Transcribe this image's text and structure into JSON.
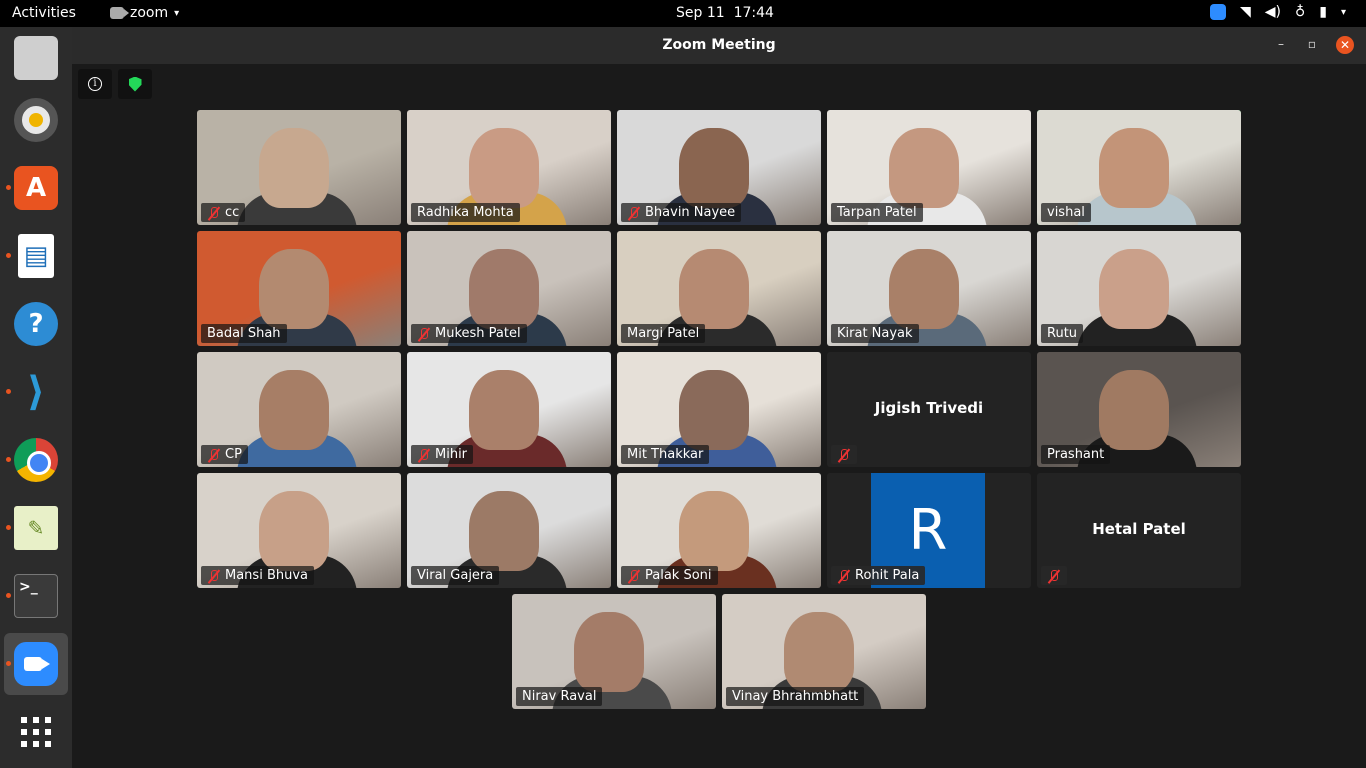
{
  "topbar": {
    "activities": "Activities",
    "app_name": "zoom",
    "app_caret": "▾",
    "date": "Sep 11",
    "time": "17:44",
    "tray_caret": "▾"
  },
  "dock": {
    "items": [
      {
        "name": "files",
        "icon": "files-icon"
      },
      {
        "name": "rhythmbox",
        "icon": "rhythmbox-icon"
      },
      {
        "name": "software",
        "icon": "software-store-icon"
      },
      {
        "name": "writer",
        "icon": "writer-icon"
      },
      {
        "name": "help",
        "icon": "help-icon"
      },
      {
        "name": "vscode",
        "icon": "vscode-icon"
      },
      {
        "name": "chrome",
        "icon": "chrome-icon"
      },
      {
        "name": "text-editor",
        "icon": "text-editor-icon"
      },
      {
        "name": "terminal",
        "icon": "terminal-icon"
      },
      {
        "name": "zoom",
        "icon": "zoom-icon"
      },
      {
        "name": "show-apps",
        "icon": "grid-icon"
      }
    ],
    "help_glyph": "?",
    "terminal_glyph": ">_",
    "store_glyph": "A",
    "writer_glyph": "▤",
    "text_glyph": "✎",
    "code_glyph": "❮❯"
  },
  "window": {
    "title": "Zoom Meeting",
    "minimize": "–",
    "maximize": "▫",
    "close": "✕",
    "info_glyph": "i"
  },
  "participants": [
    {
      "name": "cc",
      "muted": true
    },
    {
      "name": "Radhika Mohta",
      "muted": false
    },
    {
      "name": "Bhavin Nayee",
      "muted": true
    },
    {
      "name": "Tarpan Patel",
      "muted": false
    },
    {
      "name": "vishal",
      "muted": false,
      "speaking": true
    },
    {
      "name": "Badal Shah",
      "muted": false
    },
    {
      "name": "Mukesh Patel",
      "muted": true
    },
    {
      "name": "Margi Patel",
      "muted": false
    },
    {
      "name": "Kirat Nayak",
      "muted": false
    },
    {
      "name": "Rutu",
      "muted": false
    },
    {
      "name": "CP",
      "muted": true
    },
    {
      "name": "Mihir",
      "muted": true
    },
    {
      "name": "Mit Thakkar",
      "muted": false
    },
    {
      "name": "Jigish Trivedi",
      "muted": true,
      "video_off": true
    },
    {
      "name": "Prashant",
      "muted": false
    },
    {
      "name": "Mansi Bhuva",
      "muted": true
    },
    {
      "name": "Viral Gajera",
      "muted": false
    },
    {
      "name": "Palak Soni",
      "muted": true
    },
    {
      "name": "Rohit Pala",
      "muted": true,
      "avatar_letter": "R"
    },
    {
      "name": "Hetal Patel",
      "muted": true,
      "video_off": true
    },
    {
      "name": "Nirav Raval",
      "muted": false
    },
    {
      "name": "Vinay Bhrahmbhatt",
      "muted": false
    }
  ],
  "colors": {
    "active_speaker": "#23d959",
    "mute": "#e33333",
    "zoom_blue": "#2d8cff",
    "ubuntu_orange": "#e95420"
  }
}
